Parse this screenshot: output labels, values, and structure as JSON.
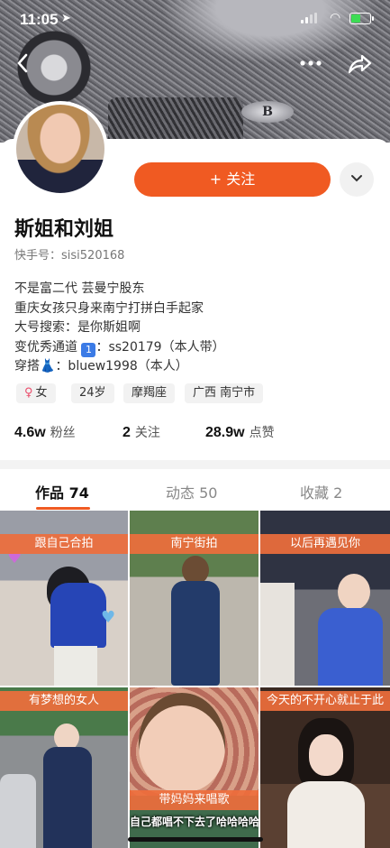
{
  "status_bar": {
    "time": "11:05",
    "location_arrow": "location-arrow-icon"
  },
  "nav": {
    "back_icon": "chevron-left-icon",
    "more_icon": "ellipsis-icon",
    "share_icon": "share-icon"
  },
  "profile": {
    "follow_label": "+ 关注",
    "dropdown_icon": "chevron-down-icon",
    "name": "斯姐和刘姐",
    "id_label": "快手号：",
    "id_value": "sisi520168",
    "bio": {
      "line1": "不是富二代 芸曼宁股东",
      "line2": "重庆女孩只身来南宁打拼白手起家",
      "line3": "大号搜索：是你斯姐啊",
      "line4_prefix": "变优秀通道",
      "line4_emoji": "1",
      "line4_suffix": "：ss20179（本人带）",
      "line5_prefix": "穿搭",
      "line5_emoji": "👗",
      "line5_suffix": "：bluew1998（本人）"
    },
    "tags": {
      "gender_icon": "♀",
      "gender": "女",
      "age": "24岁",
      "zodiac": "摩羯座",
      "location": "广西 南宁市"
    },
    "stats": {
      "fans_value": "4.6w",
      "fans_label": "粉丝",
      "following_value": "2",
      "following_label": "关注",
      "likes_value": "28.9w",
      "likes_label": "点赞"
    }
  },
  "tabs": [
    {
      "label": "作品 74",
      "active": true
    },
    {
      "label": "动态 50",
      "active": false
    },
    {
      "label": "收藏 2",
      "active": false
    }
  ],
  "posts": [
    {
      "caption": "跟自己合拍"
    },
    {
      "caption": "南宁街拍"
    },
    {
      "caption": "以后再遇见你"
    },
    {
      "caption": "有梦想的女人"
    },
    {
      "caption": "带妈妈来唱歌",
      "subtitle": "自己都唱不下去了哈哈哈哈"
    },
    {
      "caption": "今天的不开心就止于此"
    }
  ],
  "colors": {
    "accent": "#f05a22",
    "caption_bg": "#ee6e3c"
  }
}
